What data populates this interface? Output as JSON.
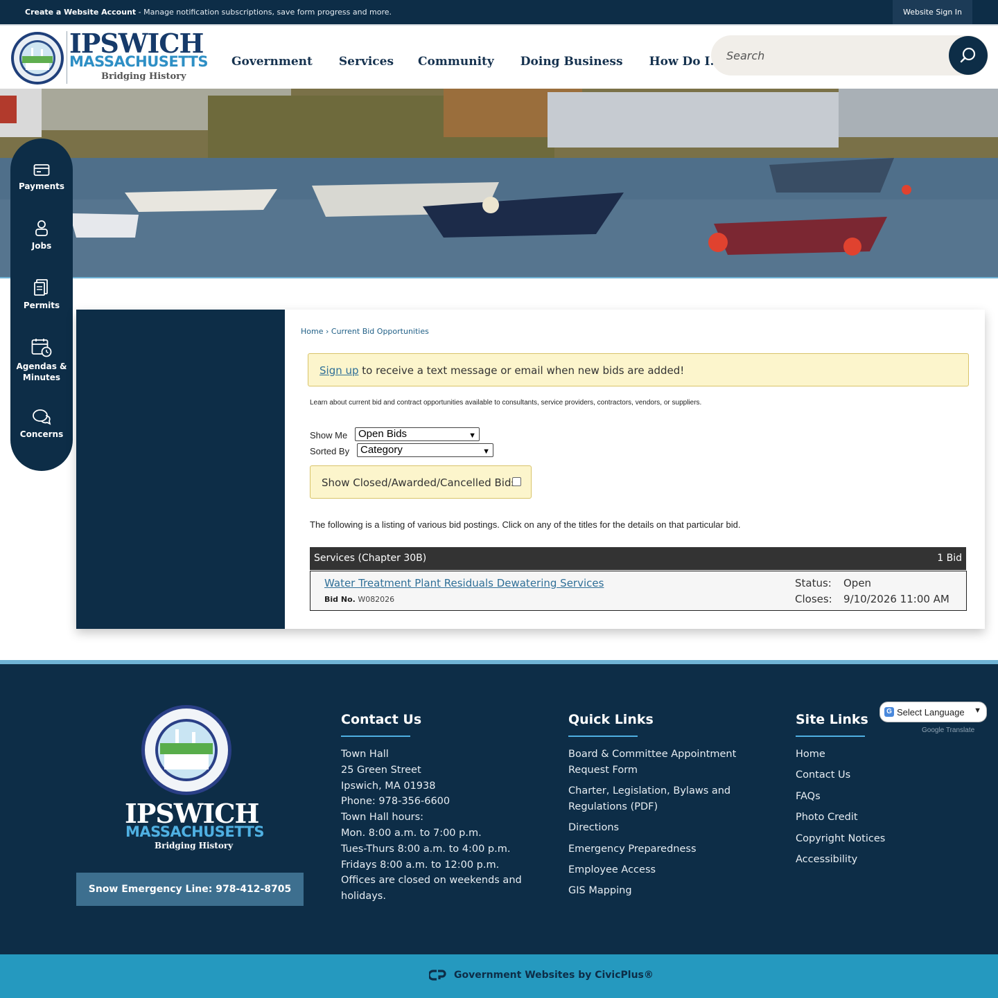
{
  "topbar": {
    "create_account_label": "Create a Website Account",
    "message": " - Manage notification subscriptions, save form progress and more.",
    "signin_label": "Website Sign In"
  },
  "header": {
    "logo_title": "IPSWICH",
    "logo_subtitle": "MASSACHUSETTS",
    "logo_tagline": "Bridging History",
    "nav": [
      "Government",
      "Services",
      "Community",
      "Doing Business",
      "How Do I..."
    ],
    "search_placeholder": "Search",
    "search_icon": "search-icon"
  },
  "sidebar": {
    "items": [
      {
        "label": "Payments",
        "icon": "credit-card-icon"
      },
      {
        "label": "Jobs",
        "icon": "person-icon"
      },
      {
        "label": "Permits",
        "icon": "document-icon"
      },
      {
        "label": "Agendas & Minutes",
        "icon": "calendar-clock-icon"
      },
      {
        "label": "Concerns",
        "icon": "chat-bubbles-icon"
      }
    ]
  },
  "main": {
    "breadcrumb": [
      "Home",
      "Current Bid Opportunities"
    ],
    "alert": {
      "link_text": "Sign up",
      "text": " to receive a text message or email when new bids are added!"
    },
    "intro": "Learn about current bid and contract opportunities available to consultants, service providers, contractors, vendors, or suppliers.",
    "show_me_label": "Show Me",
    "show_me_value": "Open Bids",
    "sorted_by_label": "Sorted By",
    "sorted_by_value": "Category",
    "show_closed_label": "Show Closed/Awarded/Cancelled Bids:",
    "show_closed_checked": false,
    "listing_intro": "The following is a listing of various bid postings. Click on any of the titles for the details on that particular bid.",
    "category": {
      "name": "Services (Chapter 30B)",
      "count": "1 Bid"
    },
    "bids": [
      {
        "title": "Water Treatment Plant Residuals Dewatering Services",
        "bid_no_label": "Bid No.",
        "bid_no": "W082026",
        "status_label": "Status:",
        "status": "Open",
        "closes_label": "Closes:",
        "closes": "9/10/2026 11:00 AM"
      }
    ]
  },
  "footer": {
    "logo_title": "IPSWICH",
    "logo_subtitle": "MASSACHUSETTS",
    "logo_tagline": "Bridging History",
    "snow_line": "Snow Emergency Line: 978-412-8705",
    "contact": {
      "title": "Contact Us",
      "lines": [
        "Town Hall",
        "25 Green Street",
        "Ipswich, MA 01938",
        "Phone: 978-356-6600",
        "Town Hall hours:",
        "Mon. 8:00 a.m. to 7:00 p.m.",
        "Tues-Thurs 8:00 a.m. to 4:00 p.m.",
        "Fridays 8:00 a.m. to 12:00 p.m.",
        "Offices are closed on weekends and",
        "holidays."
      ]
    },
    "quick_links": {
      "title": "Quick Links",
      "items": [
        [
          "Board & Committee Appointment",
          "Request Form"
        ],
        [
          "Charter, Legislation, Bylaws and",
          "Regulations (PDF)"
        ],
        [
          "Directions"
        ],
        [
          "Emergency Preparedness"
        ],
        [
          "Employee Access"
        ],
        [
          "GIS Mapping"
        ]
      ]
    },
    "site_links": {
      "title": "Site Links",
      "items": [
        "Home",
        "Contact Us",
        "FAQs",
        "Photo Credit",
        "Copyright Notices",
        "Accessibility"
      ]
    },
    "translate": {
      "label": "Select Language",
      "powered_by": "Google",
      "translate_word": "Translate"
    },
    "civicplus": "Government Websites by CivicPlus®"
  },
  "colors": {
    "navy": "#0d2d47",
    "accent_blue": "#2599bf",
    "link_blue": "#2f6f97",
    "alert_bg": "#fcf5cc"
  }
}
